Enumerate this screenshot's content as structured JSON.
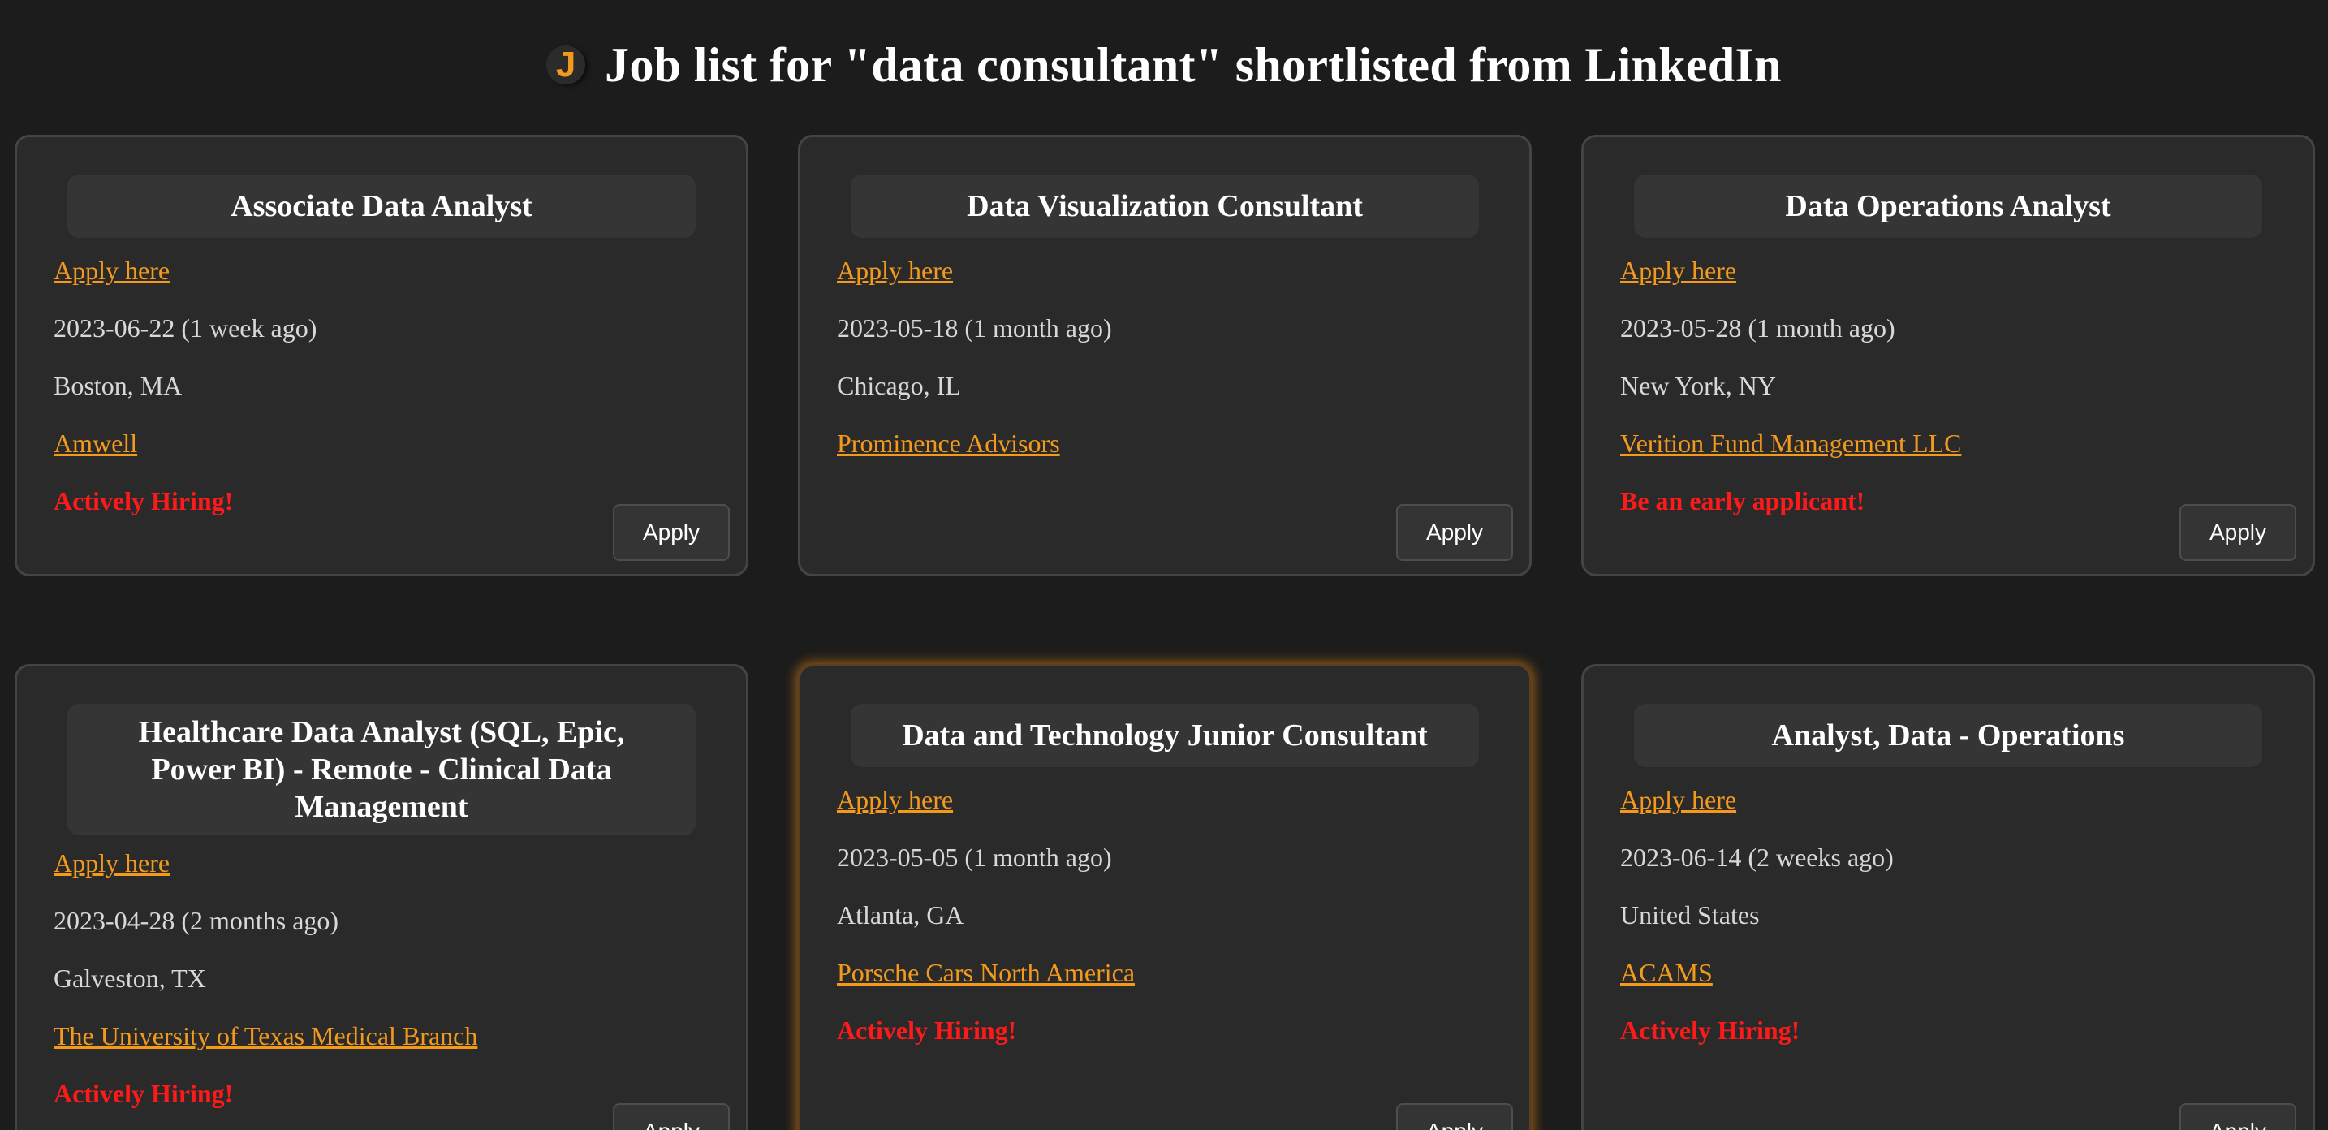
{
  "header": {
    "logo_letter": "J",
    "title": "Job list for \"data consultant\" shortlisted from LinkedIn"
  },
  "colors": {
    "background": "#1c1c1c",
    "card": "#2a2a2a",
    "accent": "#f39a1c",
    "hiring": "#ff1a1a"
  },
  "jobs": [
    {
      "title": "Associate Data Analyst",
      "apply_link": "Apply here",
      "date": "2023-06-22 (1 week ago)",
      "location": "Boston, MA",
      "company": "Amwell",
      "status": "Actively Hiring!",
      "button": "Apply"
    },
    {
      "title": "Data Visualization Consultant",
      "apply_link": "Apply here",
      "date": "2023-05-18 (1 month ago)",
      "location": "Chicago, IL",
      "company": "Prominence Advisors",
      "status": "",
      "button": "Apply"
    },
    {
      "title": "Data Operations Analyst",
      "apply_link": "Apply here",
      "date": "2023-05-28 (1 month ago)",
      "location": "New York, NY",
      "company": "Verition Fund Management LLC",
      "status": "Be an early applicant!",
      "button": "Apply"
    },
    {
      "title": "Healthcare Data Analyst (SQL, Epic, Power BI) - Remote - Clinical Data Management",
      "apply_link": "Apply here",
      "date": "2023-04-28 (2 months ago)",
      "location": "Galveston, TX",
      "company": "The University of Texas Medical Branch",
      "status": "Actively Hiring!",
      "button": "Apply"
    },
    {
      "title": "Data and Technology Junior Consultant",
      "apply_link": "Apply here",
      "date": "2023-05-05 (1 month ago)",
      "location": "Atlanta, GA",
      "company": "Porsche Cars North America",
      "status": "Actively Hiring!",
      "button": "Apply"
    },
    {
      "title": "Analyst, Data - Operations",
      "apply_link": "Apply here",
      "date": "2023-06-14 (2 weeks ago)",
      "location": "United States",
      "company": "ACAMS",
      "status": "Actively Hiring!",
      "button": "Apply"
    }
  ]
}
